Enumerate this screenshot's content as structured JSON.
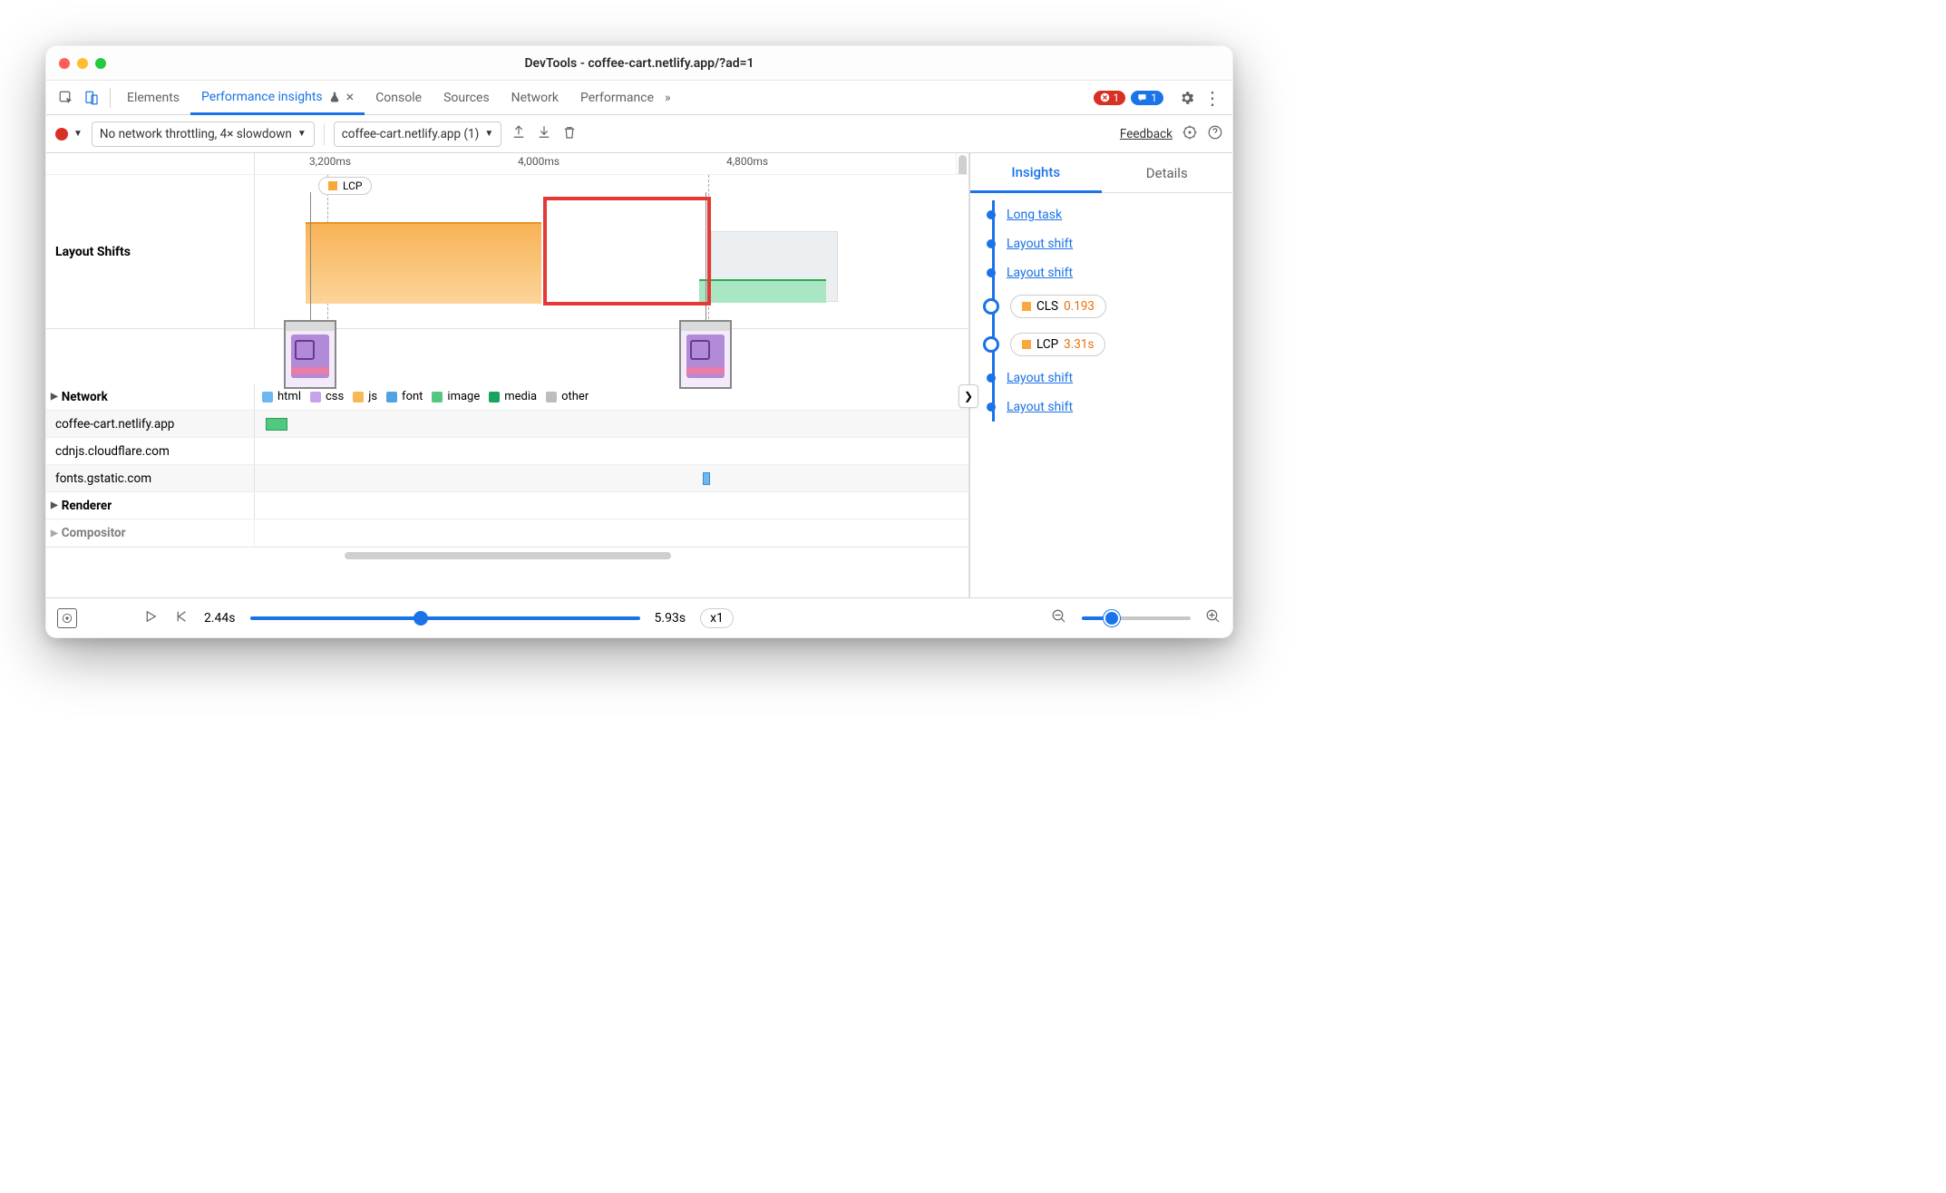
{
  "window": {
    "title": "DevTools - coffee-cart.netlify.app/?ad=1"
  },
  "tabs": {
    "elements": "Elements",
    "perf_insights": "Performance insights",
    "console": "Console",
    "sources": "Sources",
    "network": "Network",
    "performance": "Performance",
    "more": "»",
    "errors": "1",
    "messages": "1"
  },
  "toolbar": {
    "throttle": "No network throttling, 4× slowdown",
    "recording": "coffee-cart.netlify.app (1)",
    "feedback": "Feedback"
  },
  "ruler": {
    "t0": "3,200ms",
    "t1": "4,000ms",
    "t2": "4,800ms"
  },
  "lcp_pill": "LCP",
  "rows": {
    "layout_shifts": "Layout Shifts",
    "network": "Network",
    "r1": "coffee-cart.netlify.app",
    "r2": "cdnjs.cloudflare.com",
    "r3": "fonts.gstatic.com",
    "renderer": "Renderer",
    "compositor": "Compositor"
  },
  "legend": {
    "html": "html",
    "css": "css",
    "js": "js",
    "font": "font",
    "image": "image",
    "media": "media",
    "other": "other"
  },
  "side": {
    "tabs": {
      "insights": "Insights",
      "details": "Details"
    },
    "items": {
      "long_task": "Long task",
      "layout_shift": "Layout shift",
      "cls_label": "CLS",
      "cls_value": "0.193",
      "lcp_label": "LCP",
      "lcp_value": "3.31s"
    }
  },
  "footer": {
    "start": "2.44s",
    "end": "5.93s",
    "speed": "x1"
  }
}
